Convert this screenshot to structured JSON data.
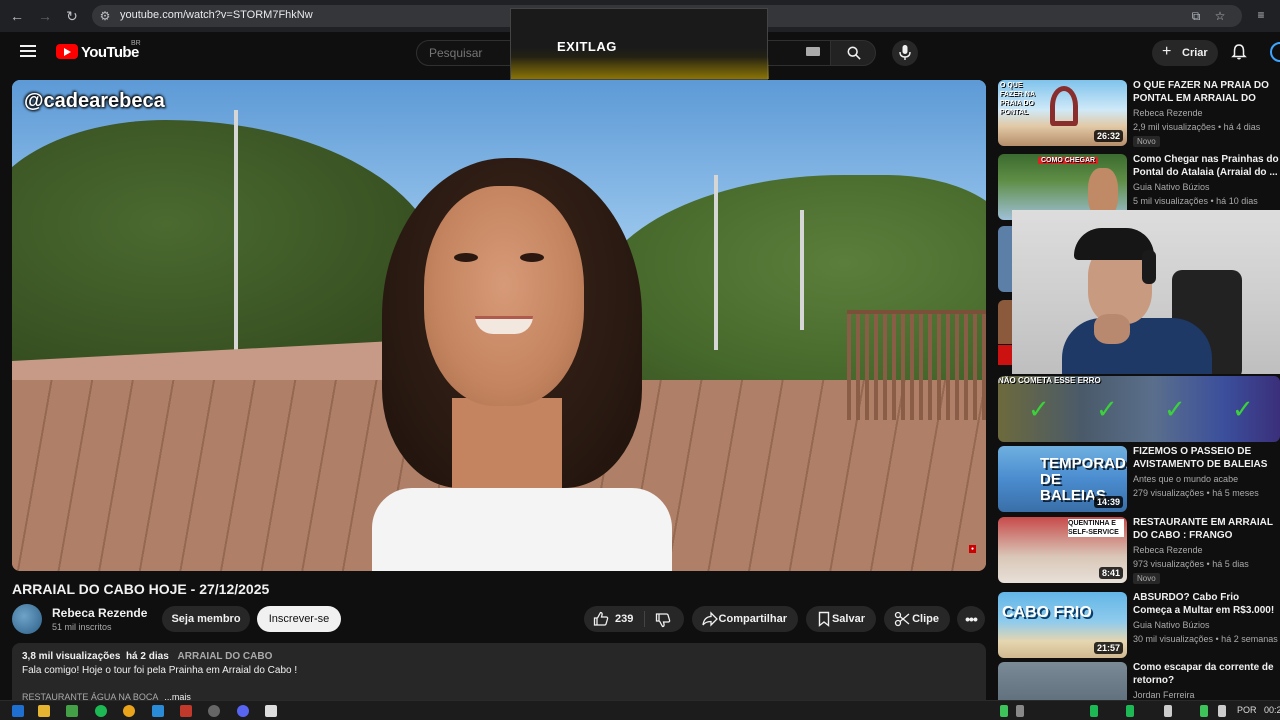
{
  "browser": {
    "url": "youtube.com/watch?v=STORM7FhkNw"
  },
  "overlay": {
    "exitlag_label": "EXITLAG"
  },
  "header": {
    "logo_text": "YouTube",
    "country_code": "BR",
    "search_placeholder": "Pesquisar",
    "create_label": "Criar"
  },
  "video": {
    "watermark": "@cadearebeca",
    "title": "ARRAIAL DO CABO HOJE - 27/12/2025",
    "channel_name": "Rebeca Rezende",
    "channel_subs": "51 mil inscritos",
    "member_label": "Seja membro",
    "subscribe_label": "Inscrever-se",
    "like_count": "239",
    "share_label": "Compartilhar",
    "save_label": "Salvar",
    "clip_label": "Clipe",
    "description": {
      "views": "3,8 mil visualizações",
      "age": "há 2 dias",
      "tag": "ARRAIAL DO CABO",
      "text": "Fala comigo! Hoje o tour foi pela Prainha em Arraial do Cabo !",
      "more_prefix": "RESTAURANTE ÁGUA NA BOCA",
      "more_label": "...mais"
    }
  },
  "sidebar": {
    "items": [
      {
        "title": "O QUE FAZER NA PRAIA DO PONTAL EM ARRAIAL DO CABO",
        "channel": "Rebeca Rezende",
        "views": "2,9 mil visualizações • há 4 dias",
        "duration": "26:32",
        "badge": "Novo",
        "thumb_text": "O QUE FAZER NA PRAIA DO PONTAL"
      },
      {
        "title": "Como Chegar nas Prainhas do Pontal do Atalaia (Arraial do ...",
        "channel": "Guia Nativo Búzios",
        "views": "5 mil visualizações • há 10 dias",
        "duration": "",
        "badge": "",
        "thumb_text": "COMO CHEGAR"
      },
      {
        "title": "NÃO COMETA ESSE ERRO",
        "channel": "",
        "views": "",
        "duration": "",
        "badge": "",
        "thumb_text": ""
      },
      {
        "title": "FIZEMOS O PASSEIO DE AVISTAMENTO DE BALEIAS E...",
        "channel": "Antes que o mundo acabe",
        "views": "279 visualizações • há 5 meses",
        "duration": "14:39",
        "badge": "",
        "thumb_text": "TEMPORADA DE BALEIAS"
      },
      {
        "title": "RESTAURANTE EM ARRAIAL DO CABO : FRANGO DOURADO...",
        "channel": "Rebeca Rezende",
        "views": "973 visualizações • há 5 dias",
        "duration": "8:41",
        "badge": "Novo",
        "thumb_text": "QUENTINHA E SELF-SERVICE"
      },
      {
        "title": "ABSURDO? Cabo Frio Começa a Multar em R$3.000! Ninguém ...",
        "channel": "Guia Nativo Búzios",
        "views": "30 mil visualizações • há 2 semanas",
        "duration": "21:57",
        "badge": "",
        "thumb_text": "CABO FRIO"
      },
      {
        "title": "Como escapar da corrente de retorno?",
        "channel": "Jordan Ferreira",
        "views": "",
        "duration": "",
        "badge": "",
        "thumb_text": ""
      }
    ]
  },
  "taskbar": {
    "language": "POR",
    "time": "00:2"
  }
}
